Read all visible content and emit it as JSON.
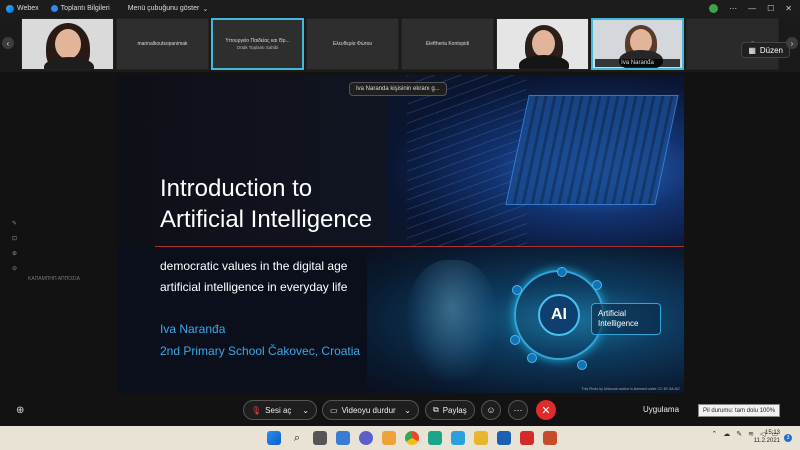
{
  "titlebar": {
    "app_name": "Webex",
    "meeting_info": "Toplantı Bilgileri",
    "menu_toggle": "Menü çubuğunu göster"
  },
  "strip": {
    "tiles": [
      {
        "name": "",
        "subtitle": ""
      },
      {
        "name": "marinalkoutsopanimak",
        "subtitle": ""
      },
      {
        "name": "Υπουργείο Παιδείας και Θρ...",
        "subtitle": "Ortak Toplantı Sahibi"
      },
      {
        "name": "Ελευθερία Φώτου",
        "subtitle": ""
      },
      {
        "name": "Eleftheria Kontopidi",
        "subtitle": ""
      },
      {
        "name": "",
        "subtitle": ""
      },
      {
        "name": "Iva Naranđa",
        "subtitle": ""
      }
    ],
    "layout_button": "Düzen"
  },
  "share_tooltip": "Iva Naranda kişisinin ekranı g...",
  "side_label": "ΚΑΠΑΜΠΗΠ ΑΠΠΟΣΙΑ",
  "slide": {
    "title_line1": "Introduction to",
    "title_line2": "Artificial Intelligence",
    "bullet1": "democratic values in the digital age",
    "bullet2": "artificial intelligence in everyday life",
    "author": "Iva Naranđa",
    "school": "2nd Primary School Čakovec, Croatia",
    "ai_label": "AI",
    "ai_box_line1": "Artificial",
    "ai_box_line2": "Intelligence",
    "credit": "This Photo by Unknown author is licensed under CC BY-SA-NC"
  },
  "controls": {
    "audio_label": "Sesi aç",
    "video_label": "Videoyu durdur",
    "share_label": "Paylaş",
    "apps_label": "Uygulama"
  },
  "battery_tooltip": "Pil durumu: tam dolu 100%",
  "clock": {
    "time": "15:13",
    "date": "11.2.2021"
  },
  "notification_count": "3"
}
